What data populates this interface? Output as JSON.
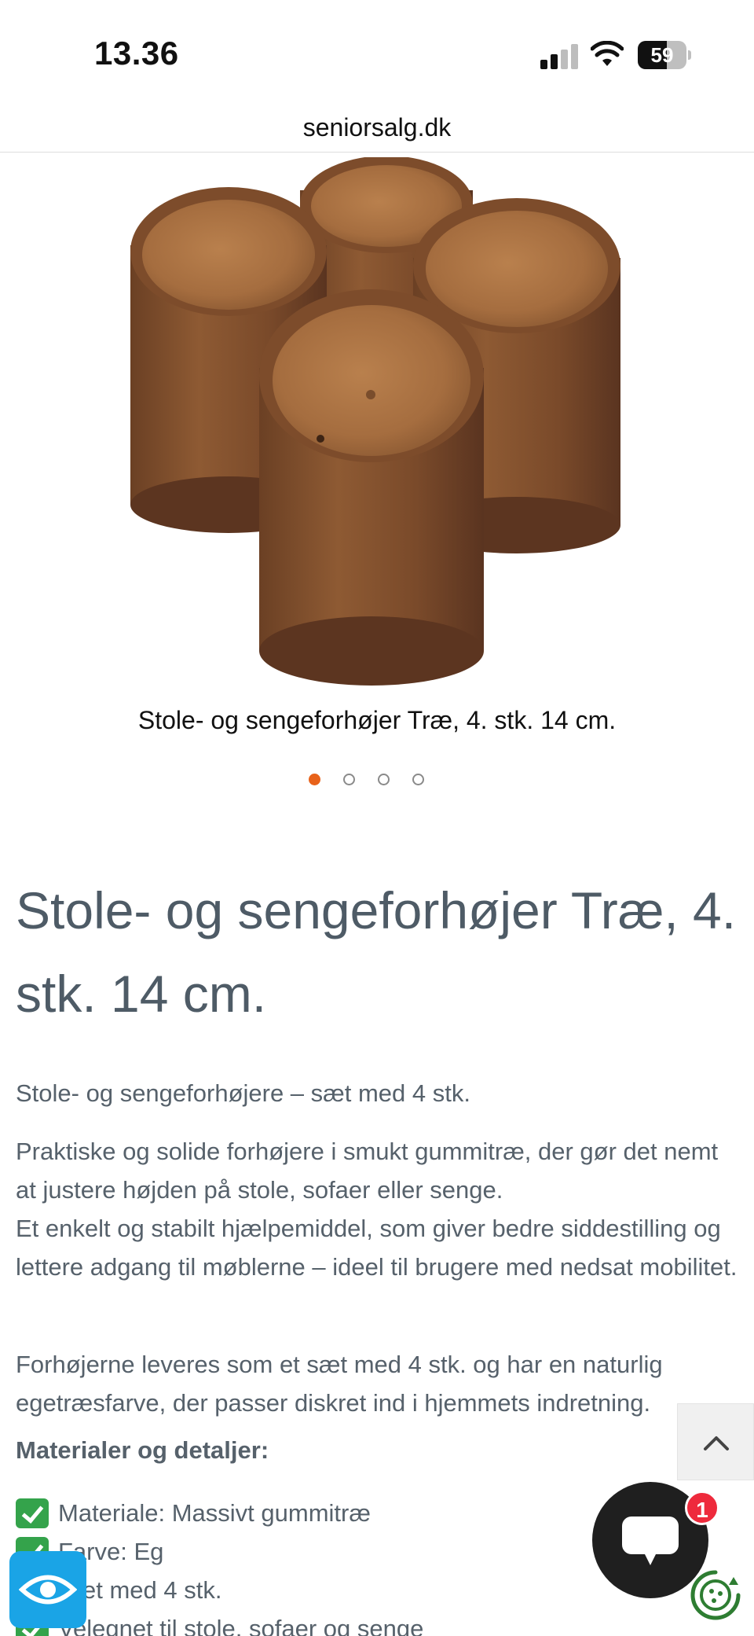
{
  "status_bar": {
    "time": "13.36",
    "battery_percent": "59",
    "signal_bars_active": 2,
    "signal_bars_total": 4
  },
  "browser": {
    "url": "seniorsalg.dk"
  },
  "carousel": {
    "caption": "Stole- og sengeforhøjer Træ, 4. stk. 14 cm.",
    "slide_count": 4,
    "active_index": 0,
    "accent_color": "#e8621a"
  },
  "product": {
    "title": "Stole- og sengeforhøjer Træ, 4. stk. 14 cm.",
    "intro": "Stole- og sengeforhøjere – sæt med 4 stk.",
    "paragraph_1": "Praktiske og solide forhøjere i smukt gummitræ, der gør det nemt at justere højden på stole, sofaer eller senge.",
    "paragraph_2": "Et enkelt og stabilt hjælpemiddel, som giver bedre siddestilling og lettere adgang til møblerne – ideel til brugere med nedsat mobilitet.",
    "paragraph_3": "Forhøjerne leveres som et sæt med 4 stk. og har en naturlig egetræsfarve, der passer diskret ind i hjemmets indretning.",
    "details_heading": "Materialer og detaljer:",
    "details": [
      "Materiale: Massivt gummitræ",
      "Farve: Eg",
      "Sæt med 4 stk.",
      "Velegnet til stole, sofaer og senge"
    ]
  },
  "widgets": {
    "chat_badge": "1",
    "chat_icon": "chat-bubble-icon",
    "scroll_icon": "chevron-up-icon",
    "accessibility_icon": "eye-icon",
    "cookie_icon": "cookie-icon",
    "colors": {
      "title": "#4e5b66",
      "text": "#56616b",
      "check": "#34a34b",
      "badge": "#ee2a3c",
      "accessibility": "#1aa4e6"
    }
  }
}
